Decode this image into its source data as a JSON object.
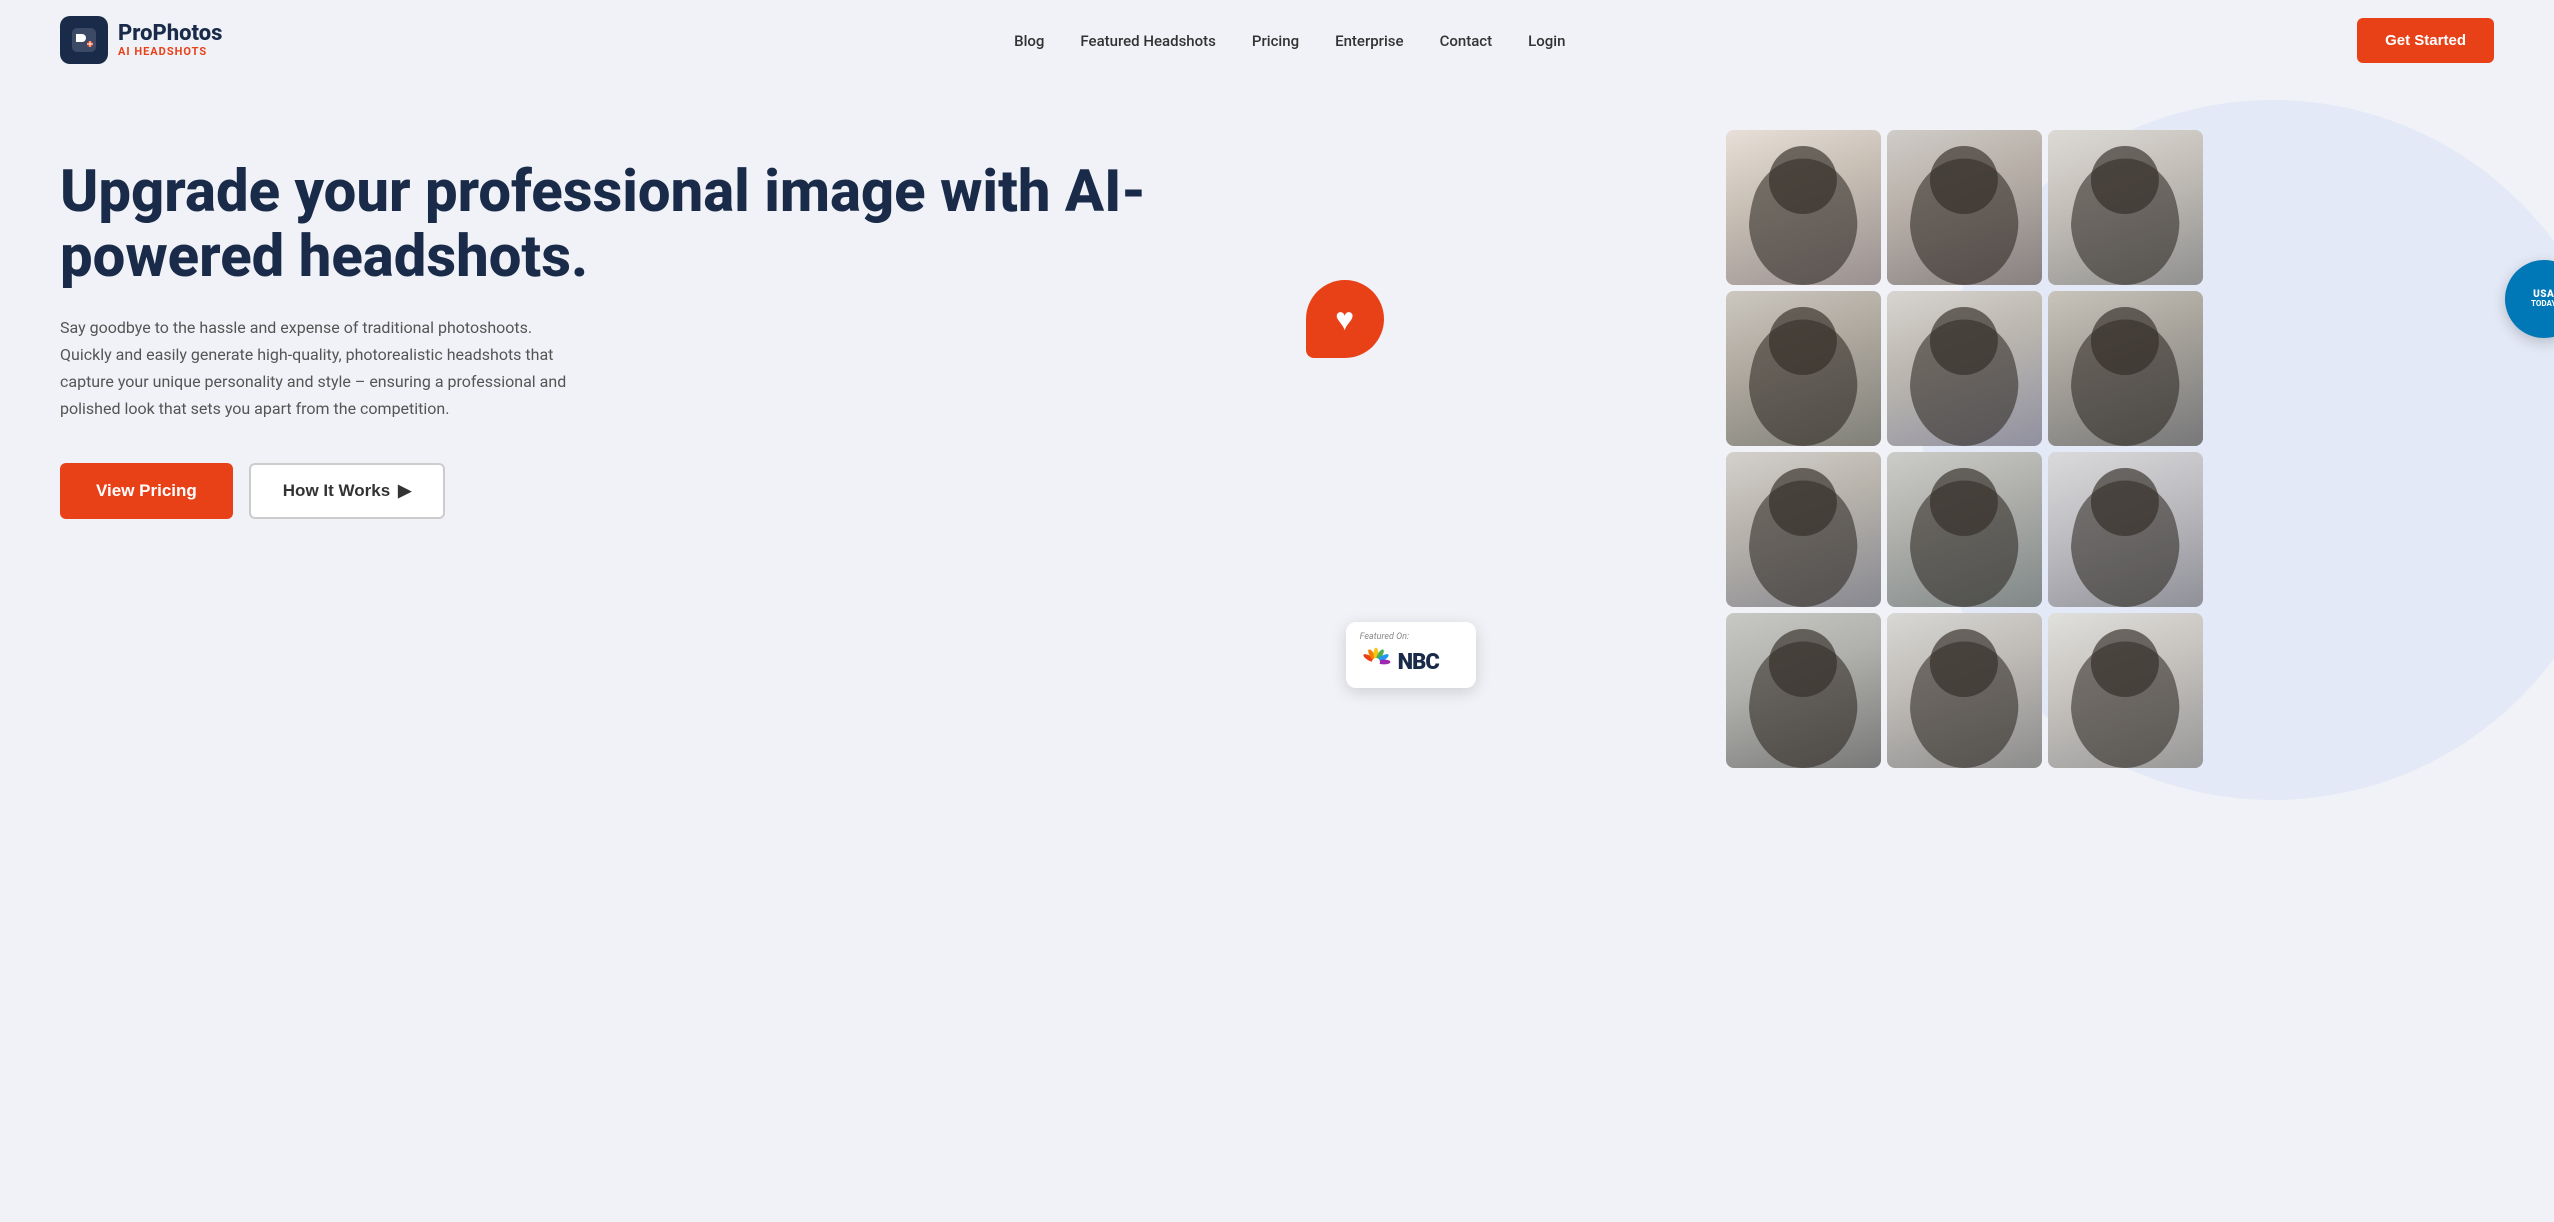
{
  "brand": {
    "icon_letter": "P",
    "name_main": "ProPhotos",
    "name_sub": "AI HEADSHOTS"
  },
  "navbar": {
    "links": [
      {
        "label": "Blog",
        "href": "#"
      },
      {
        "label": "Featured Headshots",
        "href": "#"
      },
      {
        "label": "Pricing",
        "href": "#"
      },
      {
        "label": "Enterprise",
        "href": "#"
      },
      {
        "label": "Contact",
        "href": "#"
      },
      {
        "label": "Login",
        "href": "#"
      }
    ],
    "cta_label": "Get Started"
  },
  "hero": {
    "title": "Upgrade your professional image with AI-powered headshots.",
    "description": "Say goodbye to the hassle and expense of traditional photoshoots. Quickly and easily generate high-quality, photorealistic headshots that capture your unique personality and style – ensuring a professional and polished look that sets you apart from the competition.",
    "btn_pricing": "View Pricing",
    "btn_how": "How It Works",
    "btn_how_icon": "▶"
  },
  "badges": {
    "nbc_featured_text": "Featured On:",
    "nbc_label": "NBC",
    "usa_today_line1": "USA",
    "usa_today_line2": "TODAY"
  },
  "photos": {
    "count": 12,
    "alt_text": "AI-generated professional headshot"
  },
  "colors": {
    "accent": "#e84118",
    "dark_navy": "#1a2b4a",
    "bg_light": "#f0f2f7",
    "usa_blue": "#0077b6"
  }
}
